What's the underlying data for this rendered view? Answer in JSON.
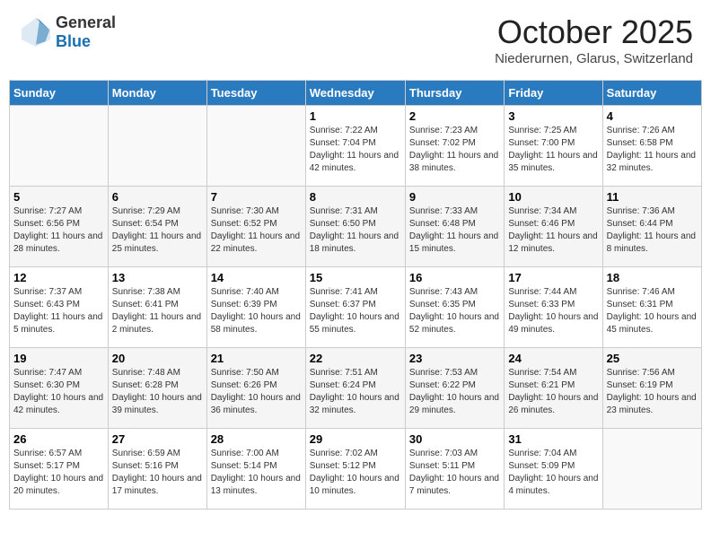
{
  "header": {
    "logo_general": "General",
    "logo_blue": "Blue",
    "month_title": "October 2025",
    "location": "Niederurnen, Glarus, Switzerland"
  },
  "days_of_week": [
    "Sunday",
    "Monday",
    "Tuesday",
    "Wednesday",
    "Thursday",
    "Friday",
    "Saturday"
  ],
  "weeks": [
    [
      {
        "day": "",
        "sunrise": "",
        "sunset": "",
        "daylight": ""
      },
      {
        "day": "",
        "sunrise": "",
        "sunset": "",
        "daylight": ""
      },
      {
        "day": "",
        "sunrise": "",
        "sunset": "",
        "daylight": ""
      },
      {
        "day": "1",
        "sunrise": "Sunrise: 7:22 AM",
        "sunset": "Sunset: 7:04 PM",
        "daylight": "Daylight: 11 hours and 42 minutes."
      },
      {
        "day": "2",
        "sunrise": "Sunrise: 7:23 AM",
        "sunset": "Sunset: 7:02 PM",
        "daylight": "Daylight: 11 hours and 38 minutes."
      },
      {
        "day": "3",
        "sunrise": "Sunrise: 7:25 AM",
        "sunset": "Sunset: 7:00 PM",
        "daylight": "Daylight: 11 hours and 35 minutes."
      },
      {
        "day": "4",
        "sunrise": "Sunrise: 7:26 AM",
        "sunset": "Sunset: 6:58 PM",
        "daylight": "Daylight: 11 hours and 32 minutes."
      }
    ],
    [
      {
        "day": "5",
        "sunrise": "Sunrise: 7:27 AM",
        "sunset": "Sunset: 6:56 PM",
        "daylight": "Daylight: 11 hours and 28 minutes."
      },
      {
        "day": "6",
        "sunrise": "Sunrise: 7:29 AM",
        "sunset": "Sunset: 6:54 PM",
        "daylight": "Daylight: 11 hours and 25 minutes."
      },
      {
        "day": "7",
        "sunrise": "Sunrise: 7:30 AM",
        "sunset": "Sunset: 6:52 PM",
        "daylight": "Daylight: 11 hours and 22 minutes."
      },
      {
        "day": "8",
        "sunrise": "Sunrise: 7:31 AM",
        "sunset": "Sunset: 6:50 PM",
        "daylight": "Daylight: 11 hours and 18 minutes."
      },
      {
        "day": "9",
        "sunrise": "Sunrise: 7:33 AM",
        "sunset": "Sunset: 6:48 PM",
        "daylight": "Daylight: 11 hours and 15 minutes."
      },
      {
        "day": "10",
        "sunrise": "Sunrise: 7:34 AM",
        "sunset": "Sunset: 6:46 PM",
        "daylight": "Daylight: 11 hours and 12 minutes."
      },
      {
        "day": "11",
        "sunrise": "Sunrise: 7:36 AM",
        "sunset": "Sunset: 6:44 PM",
        "daylight": "Daylight: 11 hours and 8 minutes."
      }
    ],
    [
      {
        "day": "12",
        "sunrise": "Sunrise: 7:37 AM",
        "sunset": "Sunset: 6:43 PM",
        "daylight": "Daylight: 11 hours and 5 minutes."
      },
      {
        "day": "13",
        "sunrise": "Sunrise: 7:38 AM",
        "sunset": "Sunset: 6:41 PM",
        "daylight": "Daylight: 11 hours and 2 minutes."
      },
      {
        "day": "14",
        "sunrise": "Sunrise: 7:40 AM",
        "sunset": "Sunset: 6:39 PM",
        "daylight": "Daylight: 10 hours and 58 minutes."
      },
      {
        "day": "15",
        "sunrise": "Sunrise: 7:41 AM",
        "sunset": "Sunset: 6:37 PM",
        "daylight": "Daylight: 10 hours and 55 minutes."
      },
      {
        "day": "16",
        "sunrise": "Sunrise: 7:43 AM",
        "sunset": "Sunset: 6:35 PM",
        "daylight": "Daylight: 10 hours and 52 minutes."
      },
      {
        "day": "17",
        "sunrise": "Sunrise: 7:44 AM",
        "sunset": "Sunset: 6:33 PM",
        "daylight": "Daylight: 10 hours and 49 minutes."
      },
      {
        "day": "18",
        "sunrise": "Sunrise: 7:46 AM",
        "sunset": "Sunset: 6:31 PM",
        "daylight": "Daylight: 10 hours and 45 minutes."
      }
    ],
    [
      {
        "day": "19",
        "sunrise": "Sunrise: 7:47 AM",
        "sunset": "Sunset: 6:30 PM",
        "daylight": "Daylight: 10 hours and 42 minutes."
      },
      {
        "day": "20",
        "sunrise": "Sunrise: 7:48 AM",
        "sunset": "Sunset: 6:28 PM",
        "daylight": "Daylight: 10 hours and 39 minutes."
      },
      {
        "day": "21",
        "sunrise": "Sunrise: 7:50 AM",
        "sunset": "Sunset: 6:26 PM",
        "daylight": "Daylight: 10 hours and 36 minutes."
      },
      {
        "day": "22",
        "sunrise": "Sunrise: 7:51 AM",
        "sunset": "Sunset: 6:24 PM",
        "daylight": "Daylight: 10 hours and 32 minutes."
      },
      {
        "day": "23",
        "sunrise": "Sunrise: 7:53 AM",
        "sunset": "Sunset: 6:22 PM",
        "daylight": "Daylight: 10 hours and 29 minutes."
      },
      {
        "day": "24",
        "sunrise": "Sunrise: 7:54 AM",
        "sunset": "Sunset: 6:21 PM",
        "daylight": "Daylight: 10 hours and 26 minutes."
      },
      {
        "day": "25",
        "sunrise": "Sunrise: 7:56 AM",
        "sunset": "Sunset: 6:19 PM",
        "daylight": "Daylight: 10 hours and 23 minutes."
      }
    ],
    [
      {
        "day": "26",
        "sunrise": "Sunrise: 6:57 AM",
        "sunset": "Sunset: 5:17 PM",
        "daylight": "Daylight: 10 hours and 20 minutes."
      },
      {
        "day": "27",
        "sunrise": "Sunrise: 6:59 AM",
        "sunset": "Sunset: 5:16 PM",
        "daylight": "Daylight: 10 hours and 17 minutes."
      },
      {
        "day": "28",
        "sunrise": "Sunrise: 7:00 AM",
        "sunset": "Sunset: 5:14 PM",
        "daylight": "Daylight: 10 hours and 13 minutes."
      },
      {
        "day": "29",
        "sunrise": "Sunrise: 7:02 AM",
        "sunset": "Sunset: 5:12 PM",
        "daylight": "Daylight: 10 hours and 10 minutes."
      },
      {
        "day": "30",
        "sunrise": "Sunrise: 7:03 AM",
        "sunset": "Sunset: 5:11 PM",
        "daylight": "Daylight: 10 hours and 7 minutes."
      },
      {
        "day": "31",
        "sunrise": "Sunrise: 7:04 AM",
        "sunset": "Sunset: 5:09 PM",
        "daylight": "Daylight: 10 hours and 4 minutes."
      },
      {
        "day": "",
        "sunrise": "",
        "sunset": "",
        "daylight": ""
      }
    ]
  ]
}
